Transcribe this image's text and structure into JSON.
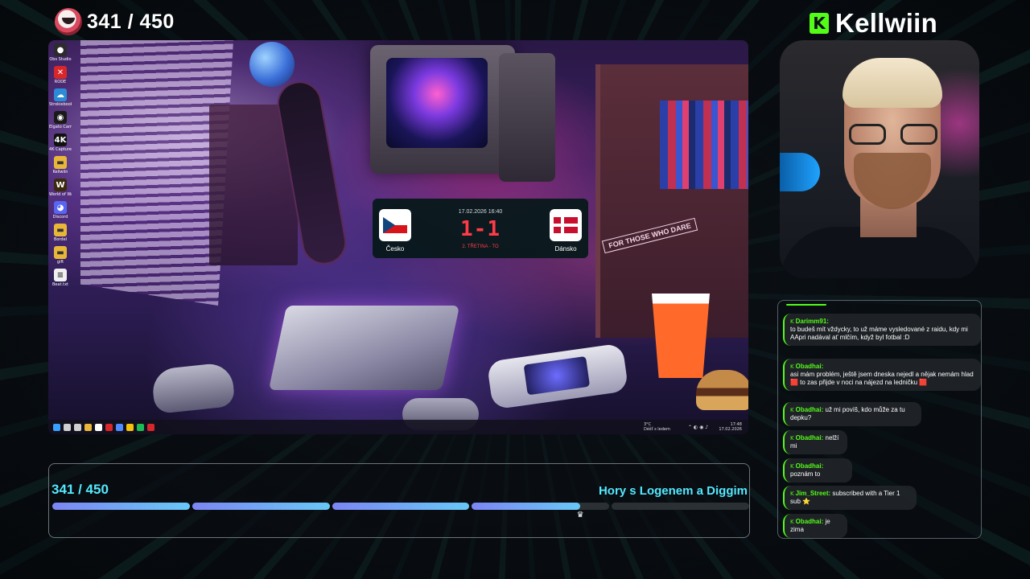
{
  "overlay": {
    "top_counter": "341 / 450",
    "brand": {
      "logo_glyph": "K",
      "name": "Kellwiin",
      "accent": "#53fc18"
    }
  },
  "desktop": {
    "icons": [
      {
        "label": "Obs Studio",
        "icon": "obs-icon",
        "color": "#2c2c2c",
        "glyph": "●"
      },
      {
        "label": "RODE",
        "icon": "rode-icon",
        "color": "#d8262b",
        "glyph": "✕"
      },
      {
        "label": "Strokiebooks",
        "icon": "cloud-app-icon",
        "color": "#2b8bd6",
        "glyph": "☁"
      },
      {
        "label": "Elgato Camera",
        "icon": "camera-icon",
        "color": "#1a1a1a",
        "glyph": "◉"
      },
      {
        "label": "4K Capture",
        "icon": "capture-icon",
        "color": "#111111",
        "glyph": "4K"
      },
      {
        "label": "Kellwiin",
        "icon": "folder-icon",
        "color": "#e8b73a",
        "glyph": "▬"
      },
      {
        "label": "World of Warcraft",
        "icon": "wow-icon",
        "color": "#3b2a0e",
        "glyph": "W"
      },
      {
        "label": "Discord",
        "icon": "discord-icon",
        "color": "#5865f2",
        "glyph": "◕"
      },
      {
        "label": "Bordel",
        "icon": "folder-icon",
        "color": "#e8b73a",
        "glyph": "▬"
      },
      {
        "label": "gift",
        "icon": "folder-icon",
        "color": "#e8b73a",
        "glyph": "▬"
      },
      {
        "label": "Beat.txt",
        "icon": "text-file-icon",
        "color": "#f0f0f0",
        "glyph": "≡"
      }
    ],
    "score": {
      "datetime": "17.02.2026 16:40",
      "score": "1-1",
      "period": "2. TŘETINA - TO",
      "home_team": "Česko",
      "away_team": "Dánsko"
    },
    "wallpaper_sign": "FOR THOSE WHO DARE",
    "taskbar": {
      "weather": "3°C\nDéšť s ledem",
      "time": "17:48",
      "date": "17.02.2026",
      "icons": [
        "windows-icon",
        "search-icon",
        "taskview-icon",
        "folder-icon",
        "app-icon",
        "close-app-icon",
        "browser-icon",
        "chrome-icon",
        "spotify-icon",
        "record-icon"
      ]
    }
  },
  "chat": {
    "messages": [
      {
        "user": "Darimm91:",
        "text": "to budeš mít vždycky, to už máme vysledované z raidu, kdy mi AApri nadával ať mlčím, když byl fotbal :D"
      },
      {
        "user": "Obadhai:",
        "text": "asi mám problém, ještě jsem dneska nejedl a nějak nemám hlad 🟥 to zas přijde v noci na nájezd na ledničku 🟥"
      },
      {
        "user": "Obadhai:",
        "text": "už mi povíš, kdo může za tu depku?"
      },
      {
        "user": "Obadhai:",
        "text": "nelží mi"
      },
      {
        "user": "Obadhai:",
        "text": "poznám to"
      },
      {
        "user": "Jim_Street:",
        "text": "subscribed with a Tier 1 sub ⭐"
      },
      {
        "user": "Obadhai:",
        "text": "je zima"
      }
    ]
  },
  "goal": {
    "count": "341 / 450",
    "title": "Hory s Logenem a Diggim",
    "current": 341,
    "target": 450,
    "segments": 5
  }
}
